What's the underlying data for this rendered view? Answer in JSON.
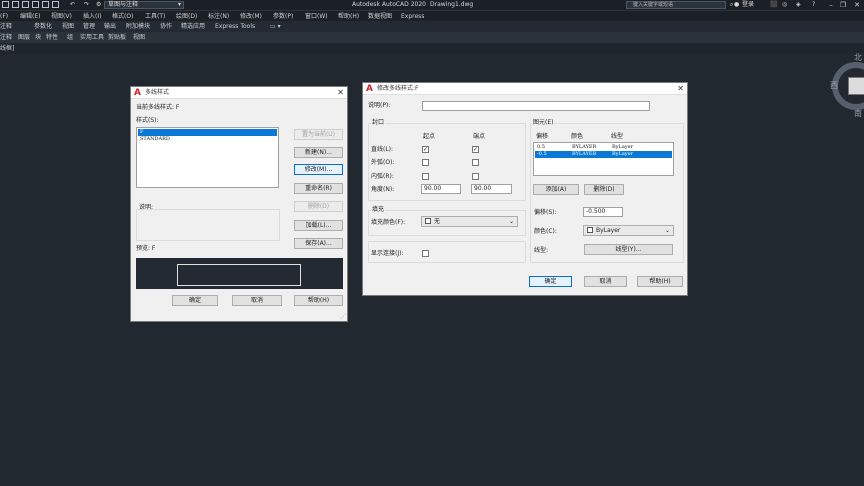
{
  "app": {
    "title": "Autodesk AutoCAD 2020",
    "filename": "Drawing1.dwg",
    "workspace": "草图与注释",
    "search_placeholder": "键入关键字或短语",
    "user_label": "登录"
  },
  "menubar": [
    "(F)",
    "编辑(E)",
    "视图(V)",
    "插入(I)",
    "格式(O)",
    "工具(T)",
    "绘图(D)",
    "标注(N)",
    "修改(M)",
    "参数(P)",
    "窗口(W)",
    "帮助(H)",
    "数据视图",
    "Express"
  ],
  "ribbon_tabs": [
    "注释",
    "参数化",
    "视图",
    "管理",
    "输出",
    "附加模块",
    "协作",
    "精选应用",
    "Express Tools"
  ],
  "panel_bar": [
    "注释",
    "图层",
    "块",
    "特性",
    "组",
    "实用工具",
    "剪贴板",
    "视图"
  ],
  "file_tab": "线框]",
  "viewcube": {
    "north": "北",
    "west": "西",
    "south": "南"
  },
  "mline_style_dialog": {
    "title": "多线样式",
    "current_style_label": "当前多线样式: F",
    "styles_label": "样式(S):",
    "styles": [
      "F",
      "STANDARD"
    ],
    "selected_style": "F",
    "description_label": "说明:",
    "preview_label": "预览: F",
    "buttons": {
      "set_current": "置为当前(U)",
      "new": "新建(N)...",
      "modify": "修改(M)...",
      "rename": "重命名(R)",
      "delete": "删除(D)",
      "load": "加载(L)...",
      "save": "保存(A)...",
      "ok": "确定",
      "cancel": "取消",
      "help": "帮助(H)"
    }
  },
  "modify_dialog": {
    "title": "修改多线样式:F",
    "description_label": "说明(P):",
    "caps": {
      "group_label": "封口",
      "start_header": "起点",
      "end_header": "端点",
      "rows": [
        {
          "label": "直线(L):",
          "start": "✓",
          "end": "✓"
        },
        {
          "label": "外弧(O):",
          "start": "",
          "end": ""
        },
        {
          "label": "内弧(R):",
          "start": "",
          "end": ""
        }
      ],
      "angle_label": "角度(N):",
      "angle_start": "90.00",
      "angle_end": "90.00"
    },
    "fill": {
      "group_label": "填充",
      "color_label": "填充颜色(F):",
      "color_value": "无"
    },
    "show_joints_label": "显示连接(J):",
    "elements": {
      "group_label": "图元(E)",
      "headers": [
        "偏移",
        "颜色",
        "线型"
      ],
      "rows": [
        {
          "offset": "0.5",
          "color": "BYLAYER",
          "linetype": "ByLayer"
        },
        {
          "offset": "-0.5",
          "color": "BYLAYER",
          "linetype": "ByLayer"
        }
      ],
      "selected_row": 1,
      "add_button": "添加(A)",
      "delete_button": "删除(D)",
      "offset_label": "偏移(S):",
      "offset_value": "-0.500",
      "color_label": "颜色(C):",
      "color_value": "ByLayer",
      "linetype_label": "线型:",
      "linetype_button": "线型(Y)..."
    },
    "buttons": {
      "ok": "确定",
      "cancel": "取消",
      "help": "帮助(H)"
    }
  },
  "colors": {
    "canvas": "#212830",
    "selection": "#0a78d7",
    "autocad_red": "#d4202b"
  }
}
